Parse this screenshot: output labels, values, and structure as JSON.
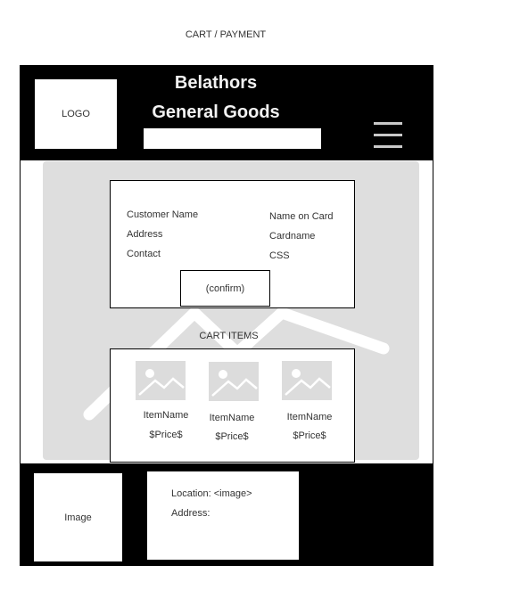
{
  "page_label": "CART / PAYMENT",
  "header": {
    "logo_label": "LOGO",
    "brand_line1": "Belathors",
    "brand_line2": "General Goods",
    "search_value": "",
    "menu_icon": "hamburger-menu-icon"
  },
  "customer": {
    "fields": [
      "Customer Name",
      "Address",
      "Contact"
    ]
  },
  "payment": {
    "fields": [
      "Name on Card",
      "Cardname",
      "CSS"
    ]
  },
  "confirm_label": "(confirm)",
  "cart": {
    "label": "CART ITEMS",
    "items": [
      {
        "name": "ItemName",
        "price": "$Price$",
        "icon": "image-placeholder-icon"
      },
      {
        "name": "ItemName",
        "price": "$Price$",
        "icon": "image-placeholder-icon"
      },
      {
        "name": "ItemName",
        "price": "$Price$",
        "icon": "image-placeholder-icon"
      }
    ]
  },
  "footer": {
    "image_label": "Image",
    "location": "Location: <image>",
    "address": "Address:"
  },
  "colors": {
    "bar": "#000000",
    "placeholder_gray": "#dedede",
    "menu_gray": "#c9c9c9"
  }
}
